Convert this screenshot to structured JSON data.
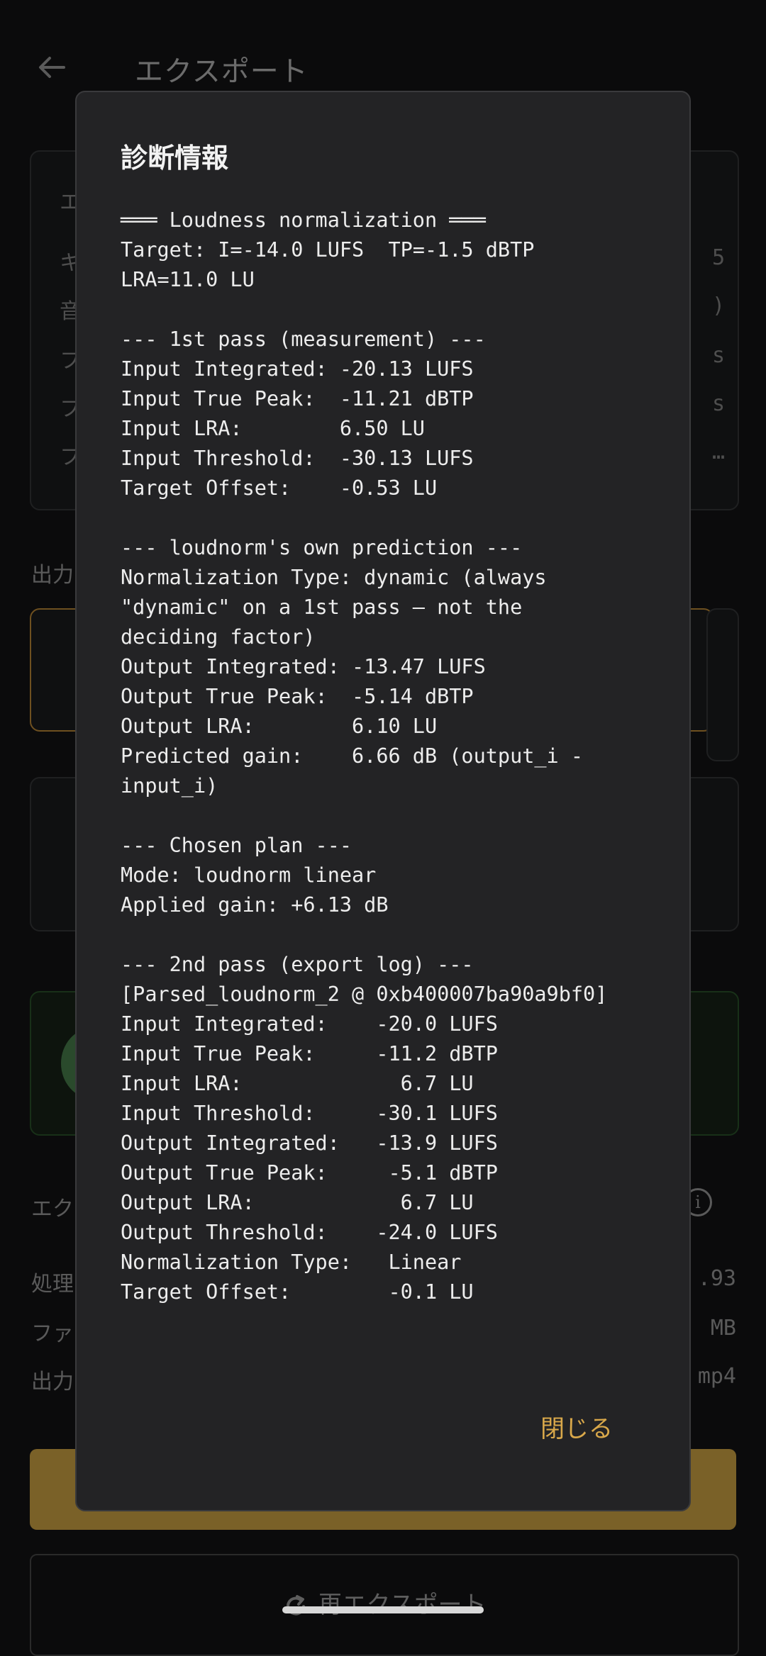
{
  "app": {
    "title": "エクスポート",
    "bg_labels": [
      "エ",
      "キ",
      "音",
      "フ",
      "フ",
      "フ"
    ],
    "bg_values": [
      "5",
      ")",
      "s",
      "s",
      "…"
    ],
    "output_section": "出力",
    "export_section": "エク",
    "stat_labels": [
      "処理",
      "ファ",
      "出力"
    ],
    "stat_values": [
      ".93",
      "MB",
      "mp4"
    ],
    "reexport_label": "再エクスポート"
  },
  "dialog": {
    "title": "診断情報",
    "lines": [
      "═══ Loudness normalization ═══",
      "Target: I=-14.0 LUFS  TP=-1.5 dBTP",
      "LRA=11.0 LU",
      "",
      "--- 1st pass (measurement) ---",
      "Input Integrated: -20.13 LUFS",
      "Input True Peak:  -11.21 dBTP",
      "Input LRA:        6.50 LU",
      "Input Threshold:  -30.13 LUFS",
      "Target Offset:    -0.53 LU",
      "",
      "--- loudnorm's own prediction ---",
      "Normalization Type: dynamic (always",
      "\"dynamic\" on a 1st pass — not the",
      "deciding factor)",
      "Output Integrated: -13.47 LUFS",
      "Output True Peak:  -5.14 dBTP",
      "Output LRA:        6.10 LU",
      "Predicted gain:    6.66 dB (output_i -",
      "input_i)",
      "",
      "--- Chosen plan ---",
      "Mode: loudnorm linear",
      "Applied gain: +6.13 dB",
      "",
      "--- 2nd pass (export log) ---",
      "[Parsed_loudnorm_2 @ 0xb400007ba90a9bf0]",
      "Input Integrated:    -20.0 LUFS",
      "Input True Peak:     -11.2 dBTP",
      "Input LRA:             6.7 LU",
      "Input Threshold:     -30.1 LUFS",
      "Output Integrated:   -13.9 LUFS",
      "Output True Peak:     -5.1 dBTP",
      "Output LRA:            6.7 LU",
      "Output Threshold:    -24.0 LUFS",
      "Normalization Type:   Linear",
      "Target Offset:        -0.1 LU"
    ],
    "close_label": "閉じる"
  },
  "colors": {
    "accent": "#d9a84a",
    "dialog_bg": "#232325",
    "page_bg": "#0b0b0c"
  }
}
